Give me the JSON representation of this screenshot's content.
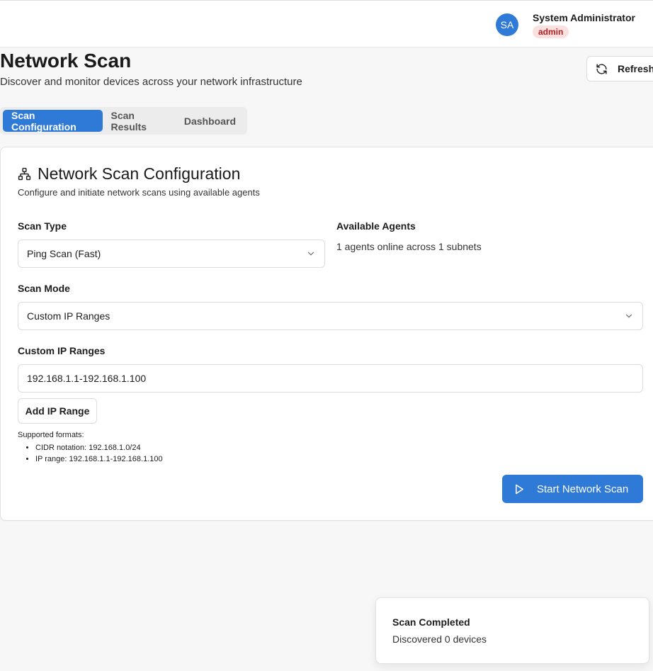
{
  "header": {
    "avatar_initials": "SA",
    "user_name": "System Administrator",
    "role": "admin"
  },
  "page": {
    "title": "Network Scan",
    "subtitle": "Discover and monitor devices across your network infrastructure",
    "refresh_label": "Refresh"
  },
  "tabs": [
    {
      "label": "Scan Configuration",
      "active": true
    },
    {
      "label": "Scan Results",
      "active": false
    },
    {
      "label": "Dashboard",
      "active": false
    }
  ],
  "config": {
    "title": "Network Scan Configuration",
    "description": "Configure and initiate network scans using available agents",
    "scan_type_label": "Scan Type",
    "scan_type_value": "Ping Scan (Fast)",
    "agents_label": "Available Agents",
    "agents_text": "1 agents online across 1 subnets",
    "scan_mode_label": "Scan Mode",
    "scan_mode_value": "Custom IP Ranges",
    "ip_ranges_label": "Custom IP Ranges",
    "ip_range_value": "192.168.1.1-192.168.1.100",
    "add_range_label": "Add IP Range",
    "formats_heading": "Supported formats:",
    "formats": [
      "CIDR notation: 192.168.1.0/24",
      "IP range: 192.168.1.1-192.168.1.100"
    ],
    "start_label": "Start Network Scan"
  },
  "toast": {
    "title": "Scan Completed",
    "description": "Discovered 0 devices"
  },
  "colors": {
    "primary": "#2f7ad6",
    "badge_bg": "#fbe0e0",
    "badge_text": "#b42020"
  },
  "icons": {
    "refresh": "refresh-icon",
    "network": "network-icon",
    "chevron": "chevron-down-icon",
    "play": "play-icon"
  }
}
